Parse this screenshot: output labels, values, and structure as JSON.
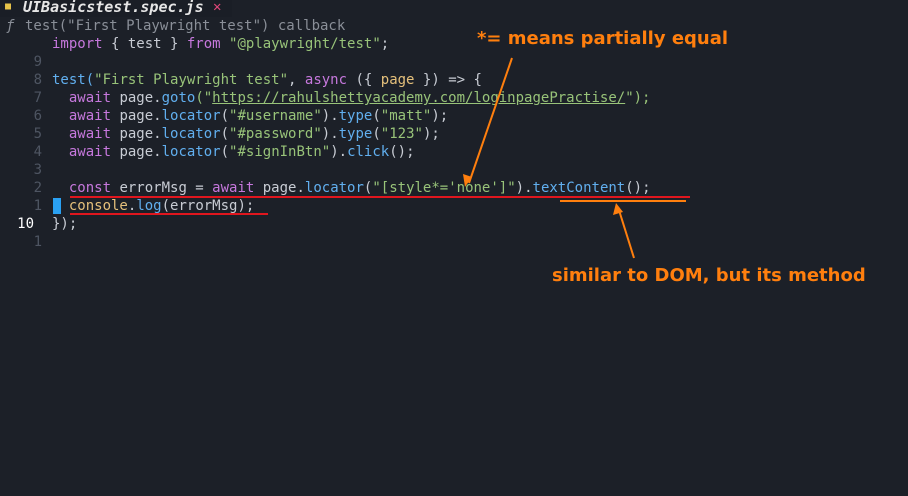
{
  "tab": {
    "lock_icon": "lock-icon",
    "title": "UIBasicstest.spec.js",
    "close_glyph": "✕"
  },
  "breadcrumb": {
    "f_glyph": "ƒ",
    "text": "test(\"First Playwright test\") callback"
  },
  "gutter": {
    "line_numbers": [
      "9",
      "8",
      "7",
      "6",
      "5",
      "4",
      "3",
      "2",
      "1",
      "10",
      "1"
    ]
  },
  "code": {
    "l1": {
      "a": "import",
      "b": " { test } ",
      "c": "from",
      "d": " ",
      "e": "\"@playwright/test\"",
      "f": ";"
    },
    "l2": {},
    "l3": {
      "a": "test(",
      "b": "\"First Playwright test\"",
      "c": ", ",
      "d": "async",
      "e": " ({ ",
      "f": "page",
      "g": " }) => {"
    },
    "l4": {
      "a": "  ",
      "b": "await",
      "c": " page.",
      "d": "goto",
      "e": "(\"",
      "f": "https://rahulshettyacademy.com/loginpagePractise/",
      "g": "\");"
    },
    "l5": {
      "a": "  ",
      "b": "await",
      "c": " page.",
      "d": "locator",
      "e": "(",
      "f": "\"#username\"",
      "g": ").",
      "h": "type",
      "i": "(",
      "j": "\"matt\"",
      "k": ");"
    },
    "l6": {
      "a": "  ",
      "b": "await",
      "c": " page.",
      "d": "locator",
      "e": "(",
      "f": "\"#password\"",
      "g": ").",
      "h": "type",
      "i": "(",
      "j": "\"123\"",
      "k": ");"
    },
    "l7": {
      "a": "  ",
      "b": "await",
      "c": " page.",
      "d": "locator",
      "e": "(",
      "f": "\"#signInBtn\"",
      "g": ").",
      "h": "click",
      "i": "();"
    },
    "l8": {},
    "l9": {
      "a": "  ",
      "b": "const",
      "c": " errorMsg = ",
      "d": "await",
      "e": " page.",
      "f": "locator",
      "g": "(",
      "h": "\"[style*='none']\"",
      "i": ").",
      "j": "textContent",
      "k": "();"
    },
    "l10": {
      "a": "  ",
      "b": "console",
      "c": ".",
      "d": "log",
      "e": "(errorMsg);"
    },
    "l11": {
      "a": "});"
    }
  },
  "annotations": {
    "top": "*= means partially equal",
    "bottom": "similar to DOM, but its method",
    "color": "#ff7f0e",
    "underline_color": "#e0161e"
  }
}
